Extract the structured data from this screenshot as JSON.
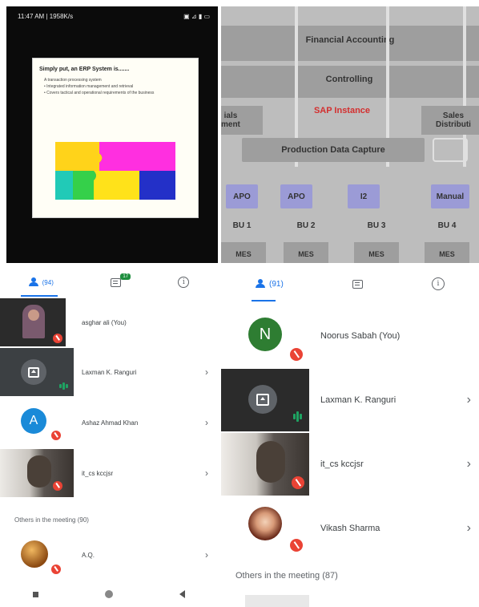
{
  "left": {
    "status_time": "11:47 AM | 1958K/s",
    "status_icons": "▣ ⊿ ▮ ▭",
    "slide": {
      "title": "Simply put, an ERP System is.......",
      "bullets": [
        "A transaction processing system",
        "• Integrated information management and retrieval",
        "• Covers tactical and operational requirements of the business"
      ]
    },
    "tabs": {
      "people_count": "(94)",
      "chat_badge": "17"
    },
    "participants": [
      {
        "name": "asghar ali (You)"
      },
      {
        "name": "Laxman K. Ranguri"
      },
      {
        "name": "Ashaz Ahmad Khan",
        "initial": "A"
      },
      {
        "name": "it_cs kccjsr"
      }
    ],
    "others_header": "Others in the meeting (90)",
    "others": [
      {
        "name": "A.Q."
      }
    ]
  },
  "right": {
    "diagram": {
      "financial": "Financial Accounting",
      "controlling": "Controlling",
      "sap_instance": "SAP Instance",
      "left_cut": "ials\nment",
      "sales": "Sales\nDistributi",
      "production": "Production Data Capture",
      "units": [
        {
          "tag": "APO",
          "bu": "BU 1",
          "mes": "MES"
        },
        {
          "tag": "APO",
          "bu": "BU 2",
          "mes": "MES"
        },
        {
          "tag": "I2",
          "bu": "BU 3",
          "mes": "MES"
        },
        {
          "tag": "Manual",
          "bu": "BU 4",
          "mes": "MES"
        }
      ]
    },
    "tabs": {
      "people_count": "(91)"
    },
    "participants": [
      {
        "name": "Noorus Sabah (You)",
        "initial": "N"
      },
      {
        "name": "Laxman K. Ranguri"
      },
      {
        "name": "it_cs kccjsr"
      },
      {
        "name": "Vikash Sharma"
      }
    ],
    "others_header": "Others in the meeting (87)"
  },
  "colors": {
    "accent": "#1a73e8",
    "mic_off": "#ea4335",
    "speaking": "#1ea362",
    "avatar_a": "#1a8ad8",
    "avatar_n": "#2e7d32",
    "sap_red": "#d32f2f"
  }
}
